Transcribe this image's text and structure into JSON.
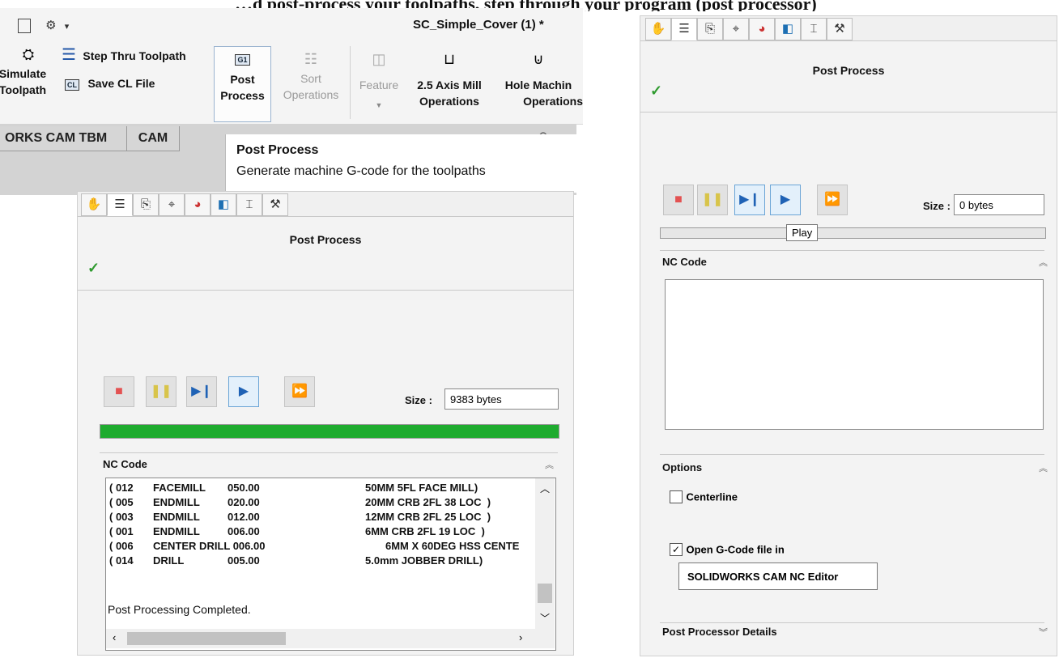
{
  "top_caption": "…d post-process your toolpaths, step through your program (post processor)",
  "ribbon": {
    "doc_title": "SC_Simple_Cover (1) *",
    "quick_access_arrow": "▾",
    "simulate_label_1": "Simulate",
    "simulate_label_2": "Toolpath",
    "step_thru_label": "Step Thru Toolpath",
    "save_cl_label": "Save CL File",
    "post_label_1": "Post",
    "post_label_2": "Process",
    "sort_label_1": "Sort",
    "sort_label_2": "Operations",
    "feature_label": "Feature",
    "mill_label_1": "2.5 Axis Mill",
    "mill_label_2": "Operations",
    "hole_label_1": "Hole Machin",
    "hole_label_2": "Operations",
    "g1_icon": "G1",
    "cl_icon": "CL"
  },
  "tabs": {
    "tbm": "ORKS CAM TBM",
    "cam": "CAM"
  },
  "tooltip": {
    "title": "Post Process",
    "description": "Generate machine G-code for the toolpaths"
  },
  "left_panel": {
    "title": "Post Process",
    "size_label": "Size :",
    "size_value": "9383 bytes",
    "progress": 1.0,
    "nc_header": "NC Code",
    "nc_lines": [
      [
        "( 012",
        "FACEMILL",
        "050.00",
        "50MM 5FL FACE MILL)"
      ],
      [
        "( 005",
        "ENDMILL",
        "020.00",
        "20MM CRB 2FL 38 LOC  )"
      ],
      [
        "( 003",
        "ENDMILL",
        "012.00",
        "12MM CRB 2FL 25 LOC  )"
      ],
      [
        "( 001",
        "ENDMILL",
        "006.00",
        "6MM CRB 2FL 19 LOC  )"
      ],
      [
        "( 006",
        "CENTER DRILL 006.00",
        "",
        "6MM X 60DEG HSS CENTE"
      ],
      [
        "( 014",
        "DRILL",
        "005.00",
        "5.0mm JOBBER DRILL)"
      ]
    ],
    "completed": "Post Processing Completed."
  },
  "right_panel": {
    "title": "Post Process",
    "size_label": "Size :",
    "size_value": "0 bytes",
    "progress": 0.0,
    "play_tooltip": "Play",
    "nc_header": "NC Code",
    "options_header": "Options",
    "centerline_label": "Centerline",
    "centerline_checked": false,
    "open_gcode_label": "Open G-Code file in",
    "open_gcode_checked": true,
    "editor_value": "SOLIDWORKS CAM NC Editor",
    "details_header": "Post Processor Details"
  },
  "colors": {
    "progress_green": "#1eab2e",
    "stop_red": "#e35252",
    "play_blue": "#1f62b5",
    "check_green": "#2e9a2e"
  }
}
